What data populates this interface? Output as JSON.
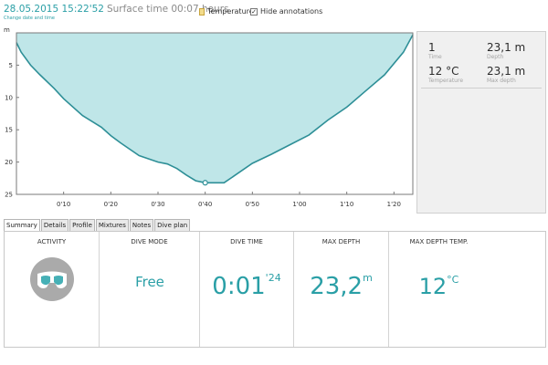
{
  "header": {
    "date_time": "28.05.2015 15:22'52",
    "surface_time": "Surface time 00:07 hours",
    "change_link": "Change date and time",
    "temperature_label": "Temperature",
    "hide_annotations_label": "Hide annotations",
    "hide_annotations_checked": true
  },
  "chart_data": {
    "type": "area",
    "ylabel": "m",
    "ylim": [
      25,
      0
    ],
    "xlim": [
      0,
      84
    ],
    "y_ticks": [
      5,
      10,
      15,
      20,
      25
    ],
    "x_ticks": [
      {
        "value": 10,
        "label": "0'10"
      },
      {
        "value": 20,
        "label": "0'20"
      },
      {
        "value": 30,
        "label": "0'30"
      },
      {
        "value": 40,
        "label": "0'40"
      },
      {
        "value": 50,
        "label": "0'50"
      },
      {
        "value": 60,
        "label": "1'00"
      },
      {
        "value": 70,
        "label": "1'10"
      },
      {
        "value": 80,
        "label": "1'20"
      }
    ],
    "x_unit": "seconds",
    "series": [
      {
        "x": [
          0,
          1,
          3,
          5,
          8,
          10,
          14,
          18,
          20,
          22,
          26,
          30,
          32,
          34,
          36,
          38,
          40,
          42,
          44,
          46,
          50,
          54,
          58,
          62,
          66,
          70,
          74,
          78,
          82,
          84
        ],
        "y": [
          1.5,
          3.0,
          5.0,
          6.5,
          8.6,
          10.2,
          12.8,
          14.6,
          15.9,
          17.0,
          19.0,
          20.0,
          20.3,
          21.0,
          22.0,
          22.9,
          23.2,
          23.2,
          23.2,
          22.2,
          20.2,
          18.8,
          17.3,
          15.8,
          13.5,
          11.5,
          9.0,
          6.5,
          3.0,
          0.3
        ]
      }
    ],
    "marker": {
      "x": 40,
      "y": 23.2
    },
    "fill_color": "#bfe6e8",
    "line_color": "#2e8f97",
    "grid": false
  },
  "stats": {
    "items": [
      {
        "value": "1",
        "label": "Time"
      },
      {
        "value": "23,1 m",
        "label": "Depth"
      },
      {
        "value": "12 °C",
        "label": "Temperature"
      },
      {
        "value": "23,1 m",
        "label": "Max depth"
      }
    ]
  },
  "tabs": [
    "Summary",
    "Details",
    "Profile",
    "Mixtures",
    "Notes",
    "Dive plan"
  ],
  "active_tab": "Summary",
  "summary": {
    "activity_title": "ACTIVITY",
    "activity_icon": "diving-mask-icon",
    "dive_mode_title": "DIVE MODE",
    "dive_mode_value": "Free",
    "dive_time_title": "DIVE TIME",
    "dive_time_value": "0:01",
    "dive_time_sec": "'24",
    "max_depth_title": "MAX DEPTH",
    "max_depth_value": "23,2",
    "max_depth_unit": "m",
    "max_temp_title": "MAX DEPTH TEMP.",
    "max_temp_value": "12",
    "max_temp_unit": "°C"
  },
  "colors": {
    "accent": "#2a9fa6",
    "fill": "#bfe6e8",
    "line": "#2e8f97",
    "icon_bg": "#aaaaaa"
  }
}
